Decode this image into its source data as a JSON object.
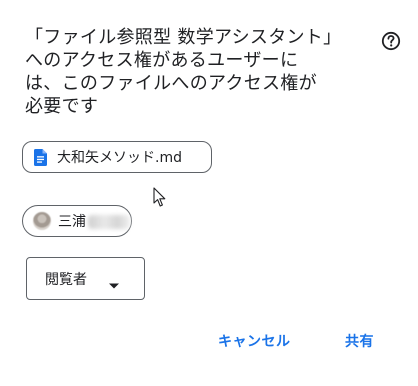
{
  "dialog": {
    "title_lines": [
      "「ファイル参照型 数学アシスタント」",
      "へのアクセス権があるユーザーに",
      "は、このファイルへのアクセス権が",
      "必要です"
    ]
  },
  "file": {
    "name": "大和矢メソッド.md",
    "icon": "google-docs-icon",
    "icon_color": "#1a73e8"
  },
  "user": {
    "name_visible": "三浦"
  },
  "role": {
    "selected": "閲覧者"
  },
  "actions": {
    "cancel_label": "キャンセル",
    "share_label": "共有"
  },
  "colors": {
    "accent": "#1a73e8",
    "text": "#202124",
    "border": "#5f6368"
  }
}
